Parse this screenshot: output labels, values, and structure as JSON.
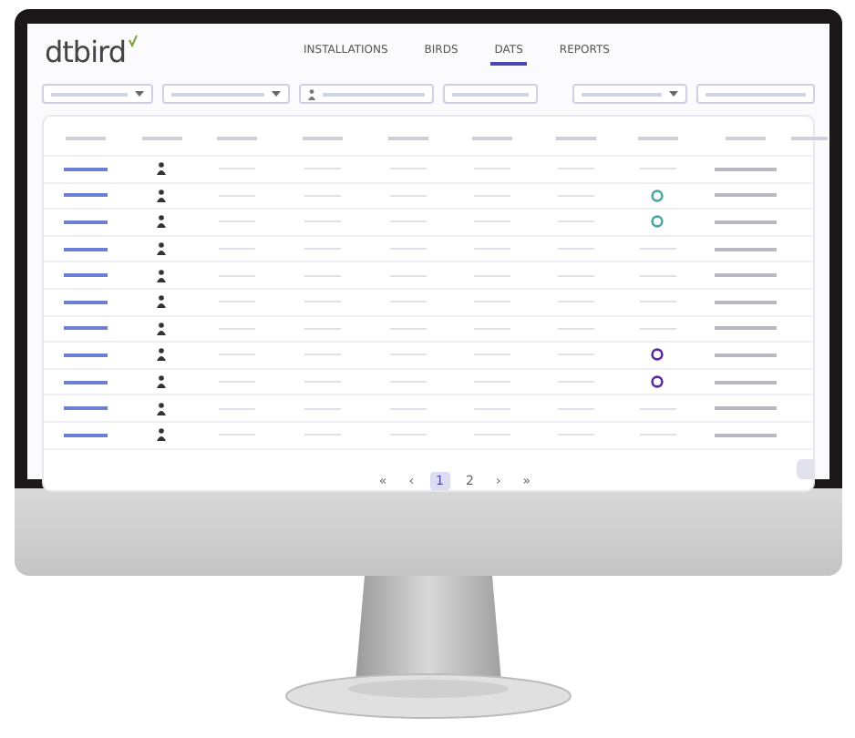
{
  "logo": "dtbird",
  "tabs": [
    {
      "label": "INSTALLATIONS",
      "selected": false
    },
    {
      "label": "BIRDS",
      "selected": false
    },
    {
      "label": "DATS",
      "selected": true
    },
    {
      "label": "REPORTS",
      "selected": false
    }
  ],
  "rows": [
    {
      "ring": false
    },
    {
      "ring": true,
      "color": "#4aa8a0"
    },
    {
      "ring": true,
      "color": "#4aa8a0"
    },
    {
      "ring": false
    },
    {
      "ring": false
    },
    {
      "ring": false
    },
    {
      "ring": false
    },
    {
      "ring": true,
      "color": "#5b2a9e"
    },
    {
      "ring": true,
      "color": "#5b2a9e"
    },
    {
      "ring": false
    },
    {
      "ring": false
    }
  ],
  "pagination": [
    {
      "label": "«",
      "selected": false
    },
    {
      "label": "‹",
      "selected": false
    },
    {
      "label": "1",
      "selected": true
    },
    {
      "label": "2",
      "selected": false
    },
    {
      "label": "›",
      "selected": false
    },
    {
      "label": "»",
      "selected": false
    }
  ]
}
